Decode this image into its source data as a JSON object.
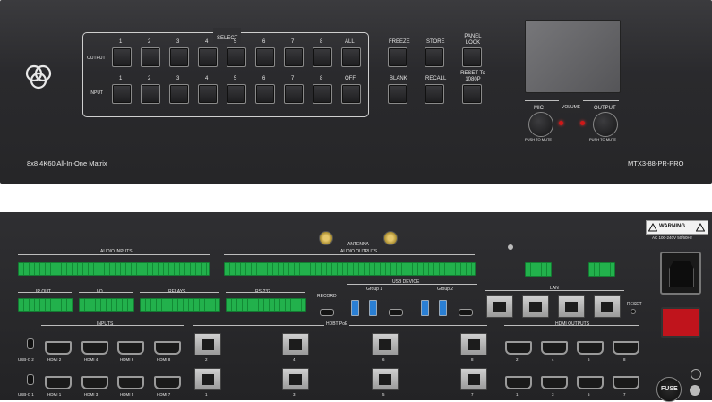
{
  "front": {
    "select_label": "SELECT",
    "output_label": "OUTPUT",
    "input_label": "INPUT",
    "output_buttons": [
      "1",
      "2",
      "3",
      "4",
      "5",
      "6",
      "7",
      "8",
      "ALL"
    ],
    "input_buttons": [
      "1",
      "2",
      "3",
      "4",
      "5",
      "6",
      "7",
      "8",
      "OFF"
    ],
    "function_buttons": {
      "freeze": "FREEZE",
      "store": "STORE",
      "panel_lock": "PANEL LOCK",
      "blank": "BLANK",
      "recall": "RECALL",
      "reset": "RESET To 1080P"
    },
    "volume_label": "VOLUME",
    "mic_label": "MIC",
    "output_knob_label": "OUTPUT",
    "push_to_mute": "PUSH TO MUTE",
    "product_desc": "8x8 4K60 All-In-One Matrix",
    "model": "MTX3-88-PR-PRO"
  },
  "rear": {
    "antenna": "ANTENNA",
    "audio_inputs": "AUDIO INPUTS",
    "audio_outputs": "AUDIO OUTPUTS",
    "ir_out": "IR OUT",
    "io": "I/O",
    "relays": "RELAYS",
    "rs232": "RS-232",
    "record": "RECORD",
    "usb_device": "USB DEVICE",
    "group1": "Group 1",
    "group2": "Group 2",
    "lan": "LAN",
    "reset": "RESET",
    "inputs": "INPUTS",
    "hdbt": "HDBT PoE",
    "hdmi_outputs": "HDMI OUTPUTS",
    "usb_c2": "USB-C 2",
    "usb_c1": "USB-C 1",
    "hdmi_in_top": [
      "HDMI 2",
      "HDMI 4",
      "HDMI 6",
      "HDMI 8"
    ],
    "hdmi_in_bottom": [
      "HDMI 1",
      "HDMI 3",
      "HDMI 5",
      "HDMI 7"
    ],
    "hdbt_top": [
      "2",
      "4",
      "6",
      "8"
    ],
    "hdbt_bottom": [
      "1",
      "3",
      "5",
      "7"
    ],
    "hdmi_out_top": [
      "2",
      "4",
      "6",
      "8"
    ],
    "hdmi_out_bottom": [
      "1",
      "3",
      "5",
      "7"
    ],
    "warning": "WARNING",
    "power": "AC 100-240V 50/60Hz",
    "fuse": "FUSE"
  },
  "colors": {
    "chassis": "#2a2a2d",
    "terminal_green": "#22b14c",
    "usb_blue": "#2a7fd4",
    "led_red": "#d01818",
    "power_switch": "#c0141c"
  }
}
